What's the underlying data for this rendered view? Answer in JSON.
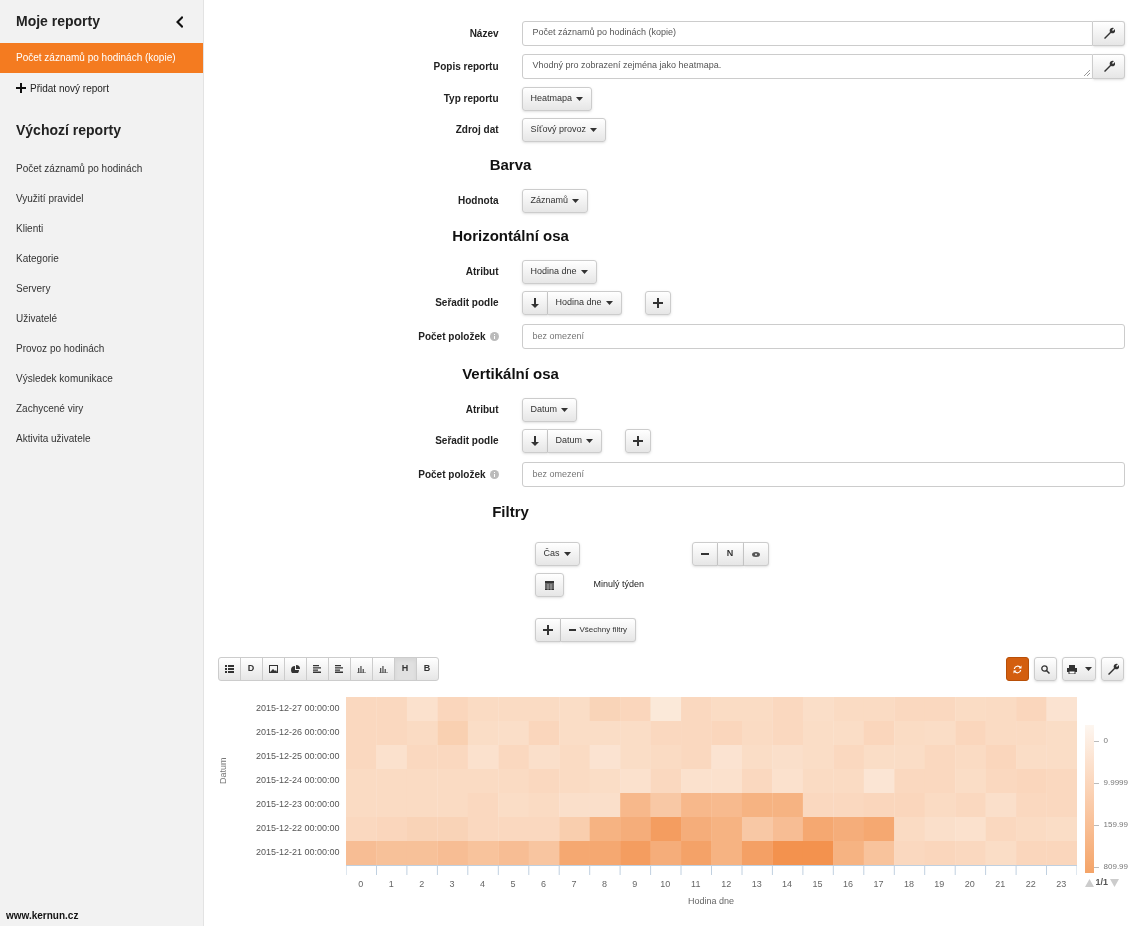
{
  "sidebar": {
    "title": "Moje reporty",
    "my_reports": [
      {
        "label": "Počet záznamů po hodinách (kopie)",
        "selected": true
      }
    ],
    "add_report": "Přidat nový report",
    "default_title": "Výchozí reporty",
    "default_reports": [
      {
        "label": "Počet záznamů po hodinách",
        "selected": false
      },
      {
        "label": "Využití pravidel",
        "selected": false
      },
      {
        "label": "Klienti",
        "selected": false
      },
      {
        "label": "Kategorie",
        "selected": false
      },
      {
        "label": "Servery",
        "selected": false
      },
      {
        "label": "Uživatelé",
        "selected": false
      },
      {
        "label": "Provoz po hodinách",
        "selected": false
      },
      {
        "label": "Výsledek komunikace",
        "selected": false
      },
      {
        "label": "Zachycené viry",
        "selected": false
      },
      {
        "label": "Aktivita uživatele",
        "selected": false
      }
    ],
    "footer": "www.kernun.cz"
  },
  "form": [
    {
      "kind": "input",
      "label": "Název",
      "value": "Počet záznamů po hodinách (kopie)"
    },
    {
      "kind": "textarea",
      "label": "Popis reportu",
      "value": "Vhodný pro zobrazení zejména jako heatmapa."
    },
    {
      "kind": "dropdown",
      "label": "Typ reportu",
      "value": "Heatmapa"
    },
    {
      "kind": "dropdown",
      "label": "Zdroj dat",
      "value": "Síťový provoz"
    },
    {
      "kind": "heading",
      "label": "Barva"
    },
    {
      "kind": "dropdown",
      "label": "Hodnota",
      "value": "Záznamů"
    },
    {
      "kind": "heading",
      "label": "Horizontální osa"
    },
    {
      "kind": "dropdown",
      "label": "Atribut",
      "value": "Hodina dne"
    },
    {
      "kind": "sort",
      "label": "Seřadit podle",
      "value": "Hodina dne"
    },
    {
      "kind": "count",
      "label": "Počet položek",
      "placeholder": "bez omezení"
    },
    {
      "kind": "heading",
      "label": "Vertikální osa"
    },
    {
      "kind": "dropdown",
      "label": "Atribut",
      "value": "Datum"
    },
    {
      "kind": "sort",
      "label": "Seřadit podle",
      "value": "Datum"
    },
    {
      "kind": "count",
      "label": "Počet položek",
      "placeholder": "bez omezení"
    },
    {
      "kind": "heading",
      "label": "Filtry"
    }
  ],
  "filters": {
    "attribute": "Čas",
    "negate": "N",
    "range": "Minulý týden",
    "remove_all": "Všechny filtry"
  },
  "toolbar": {
    "views": [
      {
        "kind": "list",
        "selected": false
      },
      {
        "kind": "text",
        "label": "D",
        "selected": false
      },
      {
        "kind": "image",
        "selected": false
      },
      {
        "kind": "pie",
        "selected": false
      },
      {
        "kind": "hbar",
        "selected": false
      },
      {
        "kind": "hbar",
        "selected": false
      },
      {
        "kind": "vbar",
        "selected": false
      },
      {
        "kind": "vbar",
        "selected": false
      },
      {
        "kind": "text",
        "label": "H",
        "selected": true
      },
      {
        "kind": "text",
        "label": "B",
        "selected": false
      }
    ],
    "actions": [
      {
        "kind": "refresh",
        "active": true
      },
      {
        "kind": "search",
        "active": false
      },
      {
        "kind": "print",
        "active": false
      },
      {
        "kind": "wrench",
        "active": false
      }
    ]
  },
  "heatmap": {
    "y_title": "Datum",
    "rows": [
      "2015-12-27 00:00:00",
      "2015-12-26 00:00:00",
      "2015-12-25 00:00:00",
      "2015-12-24 00:00:00",
      "2015-12-23 00:00:00",
      "2015-12-22 00:00:00",
      "2015-12-21 00:00:00"
    ],
    "columns": [
      "0",
      "1",
      "2",
      "3",
      "4",
      "5",
      "6",
      "7",
      "8",
      "9",
      "10",
      "11",
      "12",
      "13",
      "14",
      "15",
      "16",
      "17",
      "18",
      "19",
      "20",
      "21",
      "22",
      "23"
    ],
    "x_title": "Hodina dne",
    "legend": [
      "0",
      "9.9999",
      "159.99",
      "809.99"
    ],
    "pager": "1/1"
  }
}
